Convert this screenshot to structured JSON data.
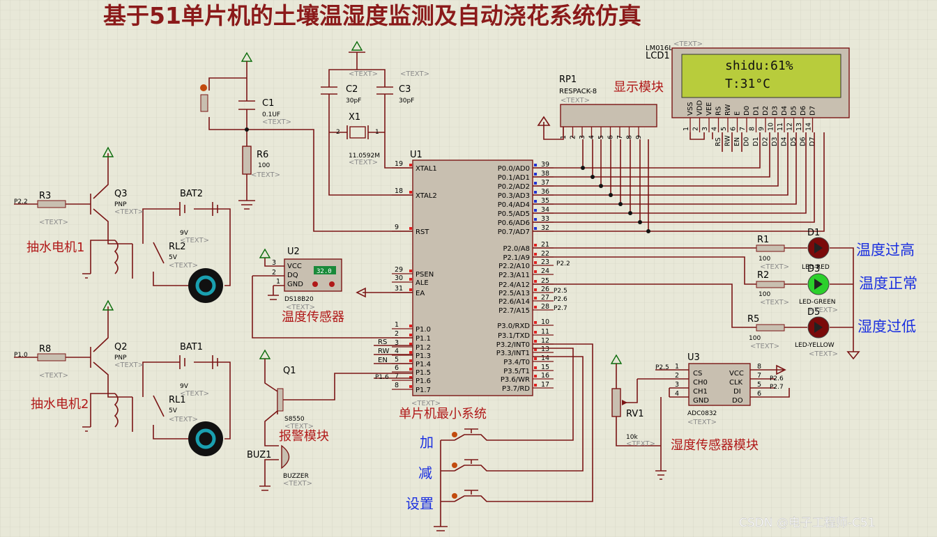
{
  "title": "基于51单片机的土壤温湿度监测及自动浇花系统仿真",
  "watermark": "CSDN @电子工程师-C51",
  "text_placeholder": "<TEXT>",
  "lcd": {
    "model": "LM016L",
    "ref": "LCD1",
    "line1": "shidu:61%",
    "line2": "T:31°C",
    "pins": [
      "VSS",
      "VDD",
      "VEE",
      "RS",
      "RW",
      "E",
      "D0",
      "D1",
      "D2",
      "D3",
      "D4",
      "D5",
      "D6",
      "D7"
    ],
    "pin_numbers": [
      "1",
      "2",
      "3",
      "4",
      "5",
      "6",
      "7",
      "8",
      "9",
      "10",
      "11",
      "12",
      "13",
      "14"
    ]
  },
  "rp1": {
    "ref": "RP1",
    "model": "RESPACK-8",
    "pins": [
      "1",
      "2",
      "3",
      "4",
      "5",
      "6",
      "7",
      "8",
      "9"
    ]
  },
  "mcu": {
    "ref": "U1",
    "left_pins": [
      {
        "num": "19",
        "name": "XTAL1"
      },
      {
        "num": "18",
        "name": "XTAL2"
      },
      {
        "num": "9",
        "name": "RST"
      },
      {
        "num": "29",
        "name": "PSEN"
      },
      {
        "num": "30",
        "name": "ALE"
      },
      {
        "num": "31",
        "name": "EA"
      },
      {
        "num": "1",
        "name": "P1.0"
      },
      {
        "num": "2",
        "name": "P1.1"
      },
      {
        "num": "3",
        "name": "P1.2"
      },
      {
        "num": "4",
        "name": "P1.3"
      },
      {
        "num": "5",
        "name": "P1.4"
      },
      {
        "num": "6",
        "name": "P1.5"
      },
      {
        "num": "7",
        "name": "P1.6"
      },
      {
        "num": "8",
        "name": "P1.7"
      }
    ],
    "right_pins": [
      {
        "num": "39",
        "name": "P0.0/AD0"
      },
      {
        "num": "38",
        "name": "P0.1/AD1"
      },
      {
        "num": "37",
        "name": "P0.2/AD2"
      },
      {
        "num": "36",
        "name": "P0.3/AD3"
      },
      {
        "num": "35",
        "name": "P0.4/AD4"
      },
      {
        "num": "34",
        "name": "P0.5/AD5"
      },
      {
        "num": "33",
        "name": "P0.6/AD6"
      },
      {
        "num": "32",
        "name": "P0.7/AD7"
      },
      {
        "num": "21",
        "name": "P2.0/A8"
      },
      {
        "num": "22",
        "name": "P2.1/A9"
      },
      {
        "num": "23",
        "name": "P2.2/A10"
      },
      {
        "num": "24",
        "name": "P2.3/A11"
      },
      {
        "num": "25",
        "name": "P2.4/A12"
      },
      {
        "num": "26",
        "name": "P2.5/A13"
      },
      {
        "num": "27",
        "name": "P2.6/A14"
      },
      {
        "num": "28",
        "name": "P2.7/A15"
      },
      {
        "num": "10",
        "name": "P3.0/RXD"
      },
      {
        "num": "11",
        "name": "P3.1/TXD"
      },
      {
        "num": "12",
        "name": "P3.2/INT0"
      },
      {
        "num": "13",
        "name": "P3.3/INT1"
      },
      {
        "num": "14",
        "name": "P3.4/T0"
      },
      {
        "num": "15",
        "name": "P3.5/T1"
      },
      {
        "num": "16",
        "name": "P3.6/WR"
      },
      {
        "num": "17",
        "name": "P3.7/RD"
      }
    ]
  },
  "net_labels": {
    "p22": "P2.2",
    "p10": "P1.0",
    "p25": "P2.5",
    "p26": "P2.6",
    "p27": "P2.7",
    "p16": "P1.6",
    "rs": "RS",
    "rw": "RW",
    "en": "EN"
  },
  "lcd_net_labels": [
    "RS",
    "RW",
    "EN",
    "D0",
    "D1",
    "D2",
    "D3",
    "D4",
    "D5",
    "D6",
    "D7"
  ],
  "parts": {
    "c1": {
      "ref": "C1",
      "val": "0.1UF"
    },
    "c2": {
      "ref": "C2",
      "val": "30pF"
    },
    "c3": {
      "ref": "C3",
      "val": "30pF"
    },
    "x1": {
      "ref": "X1",
      "val": "11.0592M",
      "pin1": "1",
      "pin2": "2"
    },
    "r6": {
      "ref": "R6",
      "val": "100"
    },
    "r3": {
      "ref": "R3"
    },
    "r8": {
      "ref": "R8"
    },
    "q3": {
      "ref": "Q3",
      "val": "PNP"
    },
    "q2": {
      "ref": "Q2",
      "val": "PNP"
    },
    "bat2": {
      "ref": "BAT2",
      "val": "9V"
    },
    "bat1": {
      "ref": "BAT1",
      "val": "9V"
    },
    "rl2": {
      "ref": "RL2",
      "val": "5V"
    },
    "rl1": {
      "ref": "RL1",
      "val": "5V"
    },
    "u2": {
      "ref": "U2",
      "val": "DS18B20",
      "pins": [
        "VCC",
        "DQ",
        "GND"
      ],
      "pin_numbers": [
        "3",
        "2",
        "1"
      ],
      "reading": "32.0"
    },
    "q1": {
      "ref": "Q1",
      "val": "S8550"
    },
    "buz": {
      "ref": "BUZ1",
      "val": "BUZZER"
    },
    "r1": {
      "ref": "R1",
      "val": "100"
    },
    "r2": {
      "ref": "R2",
      "val": "100"
    },
    "r5": {
      "ref": "R5",
      "val": "100"
    },
    "d1": {
      "ref": "D1",
      "val": "LED-RED"
    },
    "d3": {
      "ref": "D3",
      "val": "LED-GREEN"
    },
    "d5": {
      "ref": "D5",
      "val": "LED-YELLOW"
    },
    "u3": {
      "ref": "U3",
      "val": "ADC0832",
      "left": [
        "CS",
        "CH0",
        "CH1",
        "GND"
      ],
      "right": [
        "VCC",
        "CLK",
        "DI",
        "DO"
      ],
      "lnums": [
        "1",
        "2",
        "3",
        "4"
      ],
      "rnums": [
        "8",
        "7",
        "5",
        "6"
      ]
    },
    "rv1": {
      "ref": "RV1",
      "val": "10k"
    }
  },
  "modules": {
    "display": "显示模块",
    "temp_sensor": "温度传感器",
    "mcu_min": "单片机最小系统",
    "alarm": "报警模块",
    "humidity_sensor": "湿度传感器模块",
    "motor1": "抽水电机1",
    "motor2": "抽水电机2",
    "temp_high": "温度过高",
    "temp_normal": "温度正常",
    "temp_low": "湿度过低",
    "btn_add": "加",
    "btn_sub": "减",
    "btn_set": "设置"
  }
}
